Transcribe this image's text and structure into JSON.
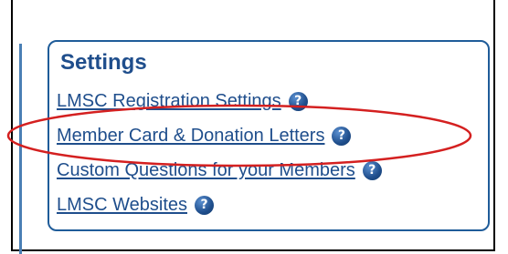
{
  "settings": {
    "title": "Settings",
    "items": [
      {
        "label": "LMSC Registration Settings",
        "icon": "help-icon",
        "icon_glyph": "?"
      },
      {
        "label": "Member Card & Donation Letters",
        "icon": "help-icon",
        "icon_glyph": "?"
      },
      {
        "label": "Custom Questions for your Members",
        "icon": "help-icon",
        "icon_glyph": "?"
      },
      {
        "label": "LMSC Websites",
        "icon": "help-icon",
        "icon_glyph": "?"
      }
    ]
  },
  "highlight": {
    "target": "Member Card & Donation Letters",
    "color": "#d42020"
  },
  "colors": {
    "link": "#1f4e8c",
    "border": "#1f5c99",
    "accent_rule": "#4a7fb5"
  }
}
